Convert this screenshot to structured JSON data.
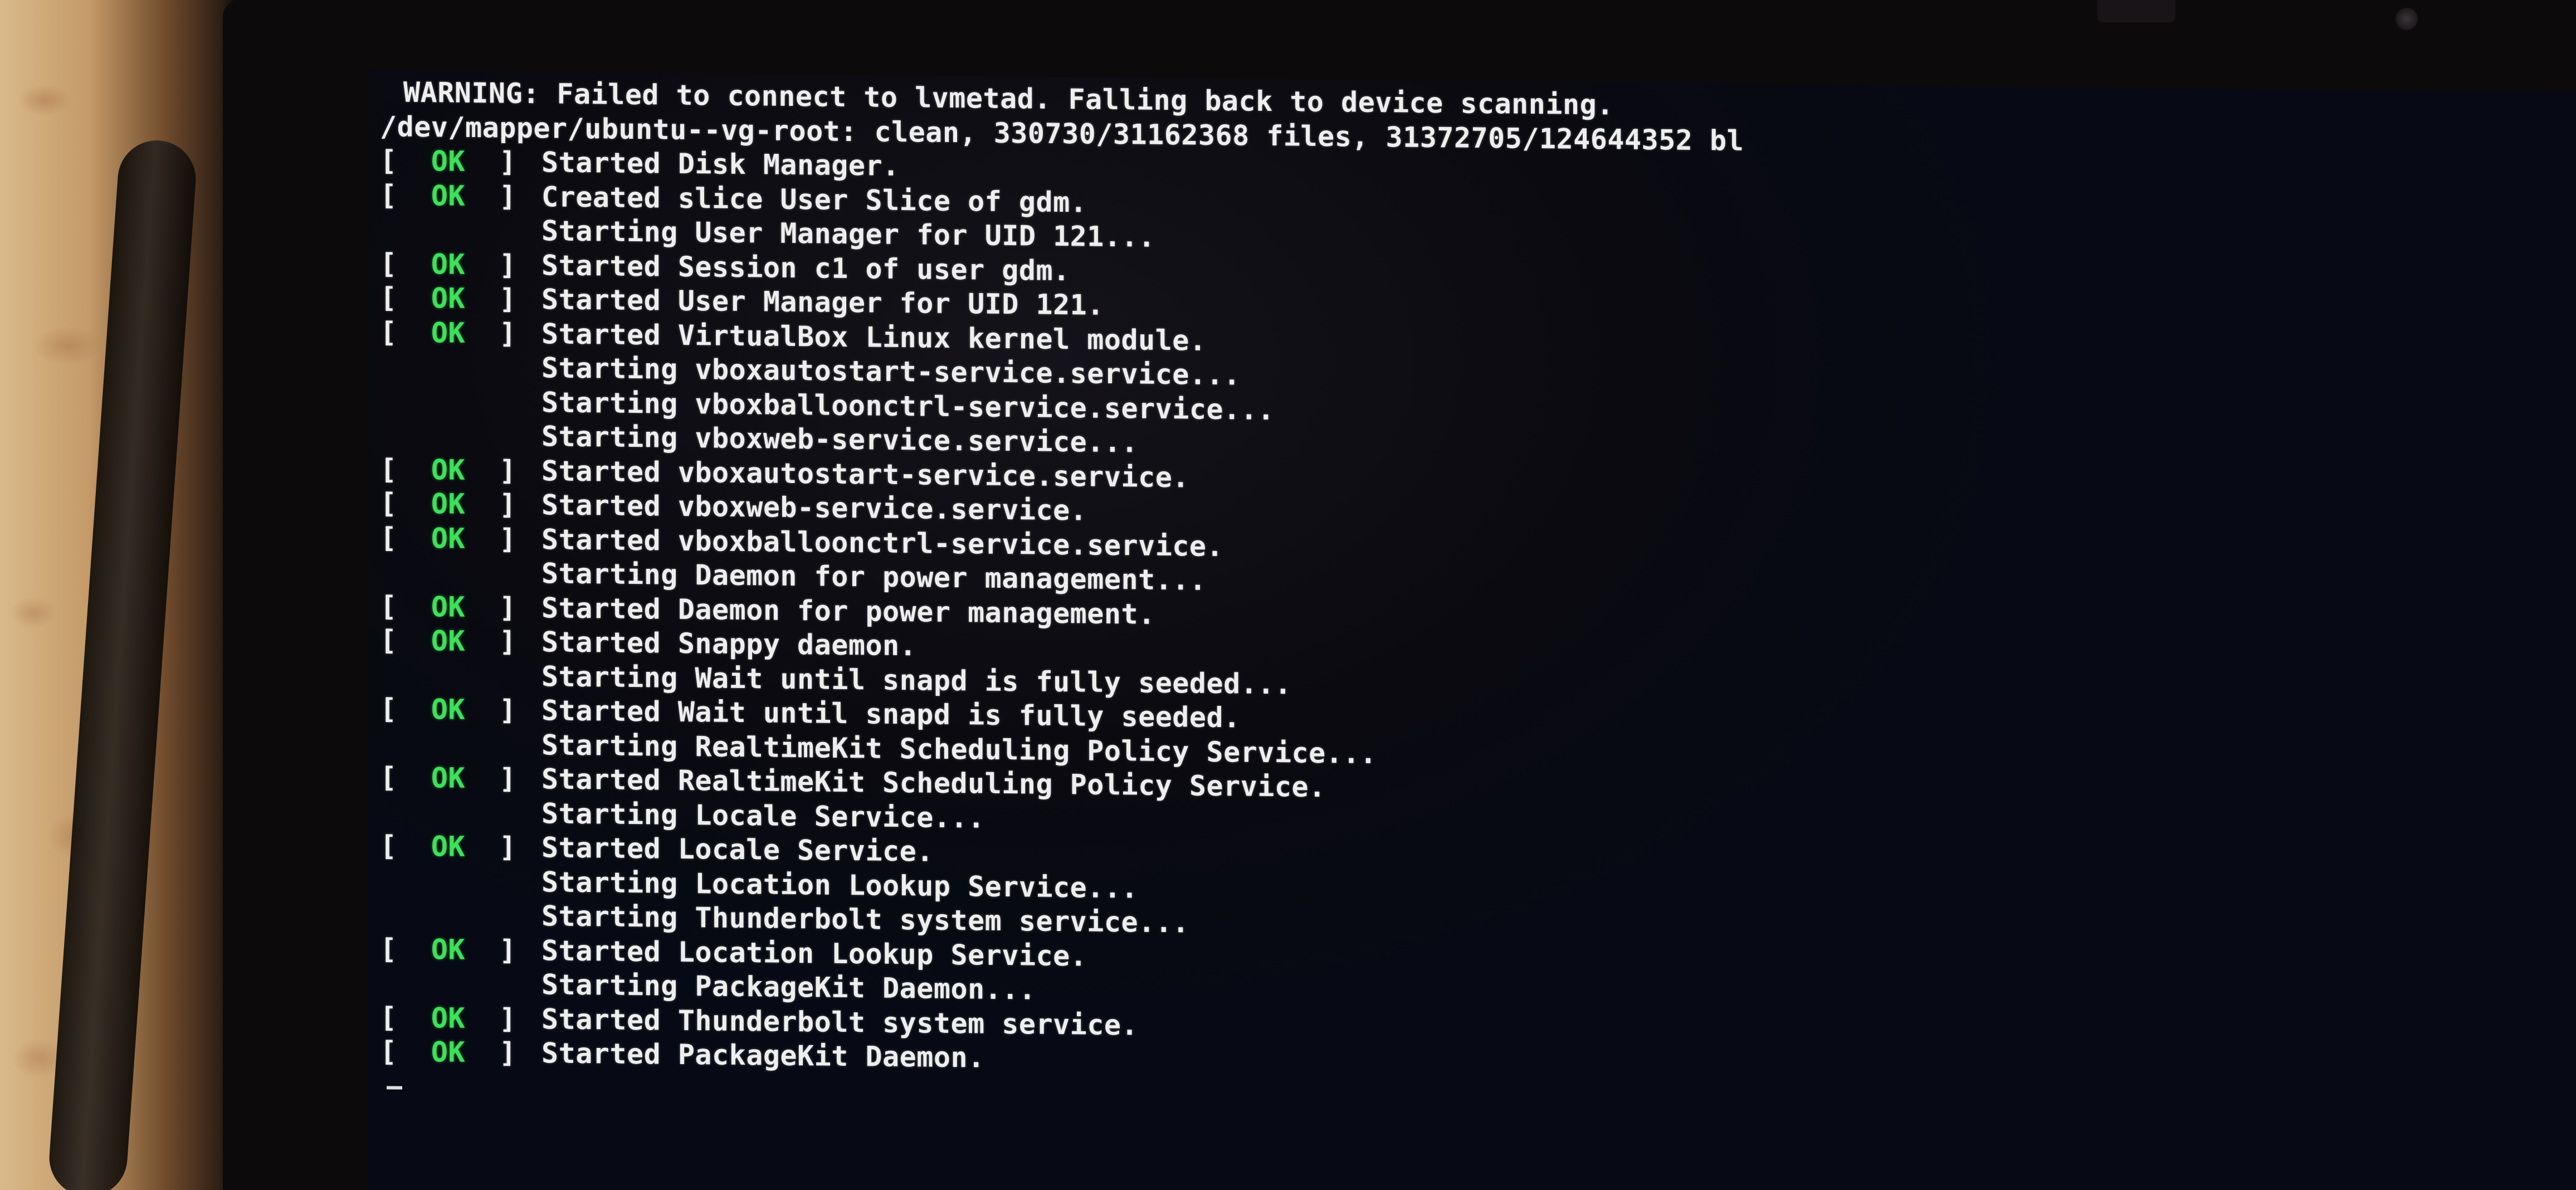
{
  "console": {
    "lines": [
      {
        "status": "",
        "text": "WARNING: Failed to connect to lvmetad. Falling back to device scanning."
      },
      {
        "status": "",
        "text": "/dev/mapper/ubuntu--vg-root: clean, 330730/31162368 files, 31372705/124644352 bl"
      },
      {
        "status": "OK",
        "text": "Started Disk Manager."
      },
      {
        "status": "OK",
        "text": "Created slice User Slice of gdm."
      },
      {
        "status": "",
        "text": "Starting User Manager for UID 121..."
      },
      {
        "status": "OK",
        "text": "Started Session c1 of user gdm."
      },
      {
        "status": "OK",
        "text": "Started User Manager for UID 121."
      },
      {
        "status": "OK",
        "text": "Started VirtualBox Linux kernel module."
      },
      {
        "status": "",
        "text": "Starting vboxautostart-service.service..."
      },
      {
        "status": "",
        "text": "Starting vboxballoonctrl-service.service..."
      },
      {
        "status": "",
        "text": "Starting vboxweb-service.service..."
      },
      {
        "status": "OK",
        "text": "Started vboxautostart-service.service."
      },
      {
        "status": "OK",
        "text": "Started vboxweb-service.service."
      },
      {
        "status": "OK",
        "text": "Started vboxballoonctrl-service.service."
      },
      {
        "status": "",
        "text": "Starting Daemon for power management..."
      },
      {
        "status": "OK",
        "text": "Started Daemon for power management."
      },
      {
        "status": "OK",
        "text": "Started Snappy daemon."
      },
      {
        "status": "",
        "text": "Starting Wait until snapd is fully seeded..."
      },
      {
        "status": "OK",
        "text": "Started Wait until snapd is fully seeded."
      },
      {
        "status": "",
        "text": "Starting RealtimeKit Scheduling Policy Service..."
      },
      {
        "status": "OK",
        "text": "Started RealtimeKit Scheduling Policy Service."
      },
      {
        "status": "",
        "text": "Starting Locale Service..."
      },
      {
        "status": "OK",
        "text": "Started Locale Service."
      },
      {
        "status": "",
        "text": "Starting Location Lookup Service..."
      },
      {
        "status": "",
        "text": "Starting Thunderbolt system service..."
      },
      {
        "status": "OK",
        "text": "Started Location Lookup Service."
      },
      {
        "status": "",
        "text": "Starting PackageKit Daemon..."
      },
      {
        "status": "OK",
        "text": "Started Thunderbolt system service."
      },
      {
        "status": "OK",
        "text": "Started PackageKit Daemon."
      }
    ],
    "ok_color": "#3ee05a",
    "text_color": "#eeeeee",
    "background_color": "#0a0a10"
  }
}
